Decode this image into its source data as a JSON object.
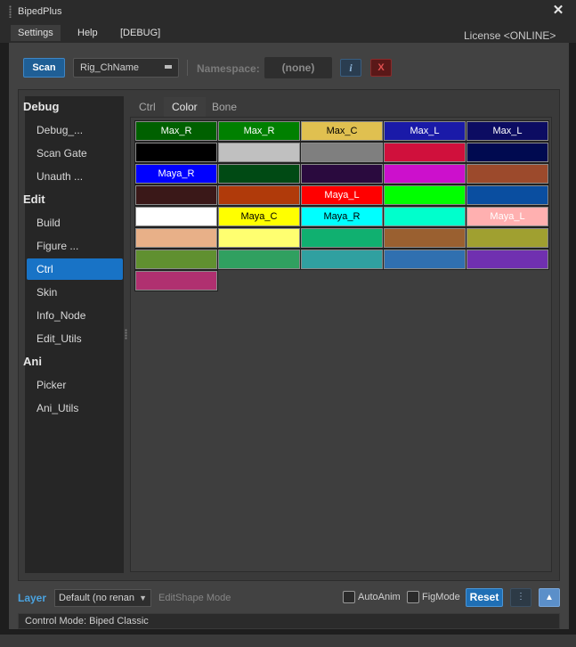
{
  "window": {
    "title": "BipedPlus"
  },
  "menu": {
    "items": [
      "Settings",
      "Help",
      "[DEBUG]"
    ],
    "license": "License <ONLINE>"
  },
  "toolbar": {
    "scan_label": "Scan",
    "rig_name": "Rig_ChName",
    "namespace_label": "Namespace:",
    "namespace_value": "(none)",
    "info_label": "i",
    "clear_label": "X"
  },
  "sidebar": {
    "items": [
      {
        "label": "Debug",
        "type": "section"
      },
      {
        "label": "Debug_...",
        "type": "child"
      },
      {
        "label": "Scan Gate",
        "type": "child"
      },
      {
        "label": "Unauth ...",
        "type": "child"
      },
      {
        "label": "Edit",
        "type": "section"
      },
      {
        "label": "Build",
        "type": "child"
      },
      {
        "label": "Figure ...",
        "type": "child"
      },
      {
        "label": "Ctrl",
        "type": "child",
        "selected": true
      },
      {
        "label": "Skin",
        "type": "child"
      },
      {
        "label": "Info_Node",
        "type": "child"
      },
      {
        "label": "Edit_Utils",
        "type": "child"
      },
      {
        "label": "Ani",
        "type": "section"
      },
      {
        "label": "Picker",
        "type": "child"
      },
      {
        "label": "Ani_Utils",
        "type": "child"
      }
    ]
  },
  "tabs": [
    {
      "label": "Ctrl"
    },
    {
      "label": "Color",
      "active": true
    },
    {
      "label": "Bone"
    }
  ],
  "palette": [
    {
      "color": "#006000",
      "label": "Max_R",
      "text": "#ffffff"
    },
    {
      "color": "#008000",
      "label": "Max_R",
      "text": "#ffffff"
    },
    {
      "color": "#e0c050",
      "label": "Max_C",
      "text": "#000000"
    },
    {
      "color": "#1a1aa8",
      "label": "Max_L",
      "text": "#ffffff"
    },
    {
      "color": "#0c0c62",
      "label": "Max_L",
      "text": "#ffffff"
    },
    {
      "color": "#000000",
      "label": ""
    },
    {
      "color": "#c0c0c0",
      "label": ""
    },
    {
      "color": "#7f7f7f",
      "label": ""
    },
    {
      "color": "#d0103c",
      "label": ""
    },
    {
      "color": "#000a50",
      "label": ""
    },
    {
      "color": "#0000ff",
      "label": "Maya_R",
      "text": "#ffffff"
    },
    {
      "color": "#004a14",
      "label": ""
    },
    {
      "color": "#2a0a3e",
      "label": ""
    },
    {
      "color": "#cc10cc",
      "label": ""
    },
    {
      "color": "#9c4a2c",
      "label": ""
    },
    {
      "color": "#3a1818",
      "label": ""
    },
    {
      "color": "#b03a0a",
      "label": ""
    },
    {
      "color": "#ff0000",
      "label": "Maya_L",
      "text": "#ffffff"
    },
    {
      "color": "#00ff00",
      "label": ""
    },
    {
      "color": "#0a4ea0",
      "label": ""
    },
    {
      "color": "#ffffff",
      "label": ""
    },
    {
      "color": "#ffff00",
      "label": "Maya_C",
      "text": "#000000"
    },
    {
      "color": "#00ffff",
      "label": "Maya_R",
      "text": "#000000"
    },
    {
      "color": "#00ffcc",
      "label": ""
    },
    {
      "color": "#ffb0b0",
      "label": "Maya_L",
      "text": "#ffffff"
    },
    {
      "color": "#e8b088",
      "label": ""
    },
    {
      "color": "#ffff70",
      "label": ""
    },
    {
      "color": "#10b070",
      "label": ""
    },
    {
      "color": "#9a6030",
      "label": ""
    },
    {
      "color": "#a0a030",
      "label": ""
    },
    {
      "color": "#609030",
      "label": ""
    },
    {
      "color": "#30a060",
      "label": ""
    },
    {
      "color": "#30a0a0",
      "label": ""
    },
    {
      "color": "#3070b0",
      "label": ""
    },
    {
      "color": "#7030b0",
      "label": ""
    },
    {
      "color": "#b03070",
      "label": ""
    }
  ],
  "bottombar": {
    "layer_label": "Layer",
    "layer_value": "Default (no renan",
    "editshape_label": "EditShape Mode",
    "autoanim_label": "AutoAnim",
    "figmode_label": "FigMode",
    "reset_label": "Reset",
    "more_label": "⋮",
    "up_label": "▲"
  },
  "status": {
    "text": "Control Mode: Biped Classic"
  }
}
